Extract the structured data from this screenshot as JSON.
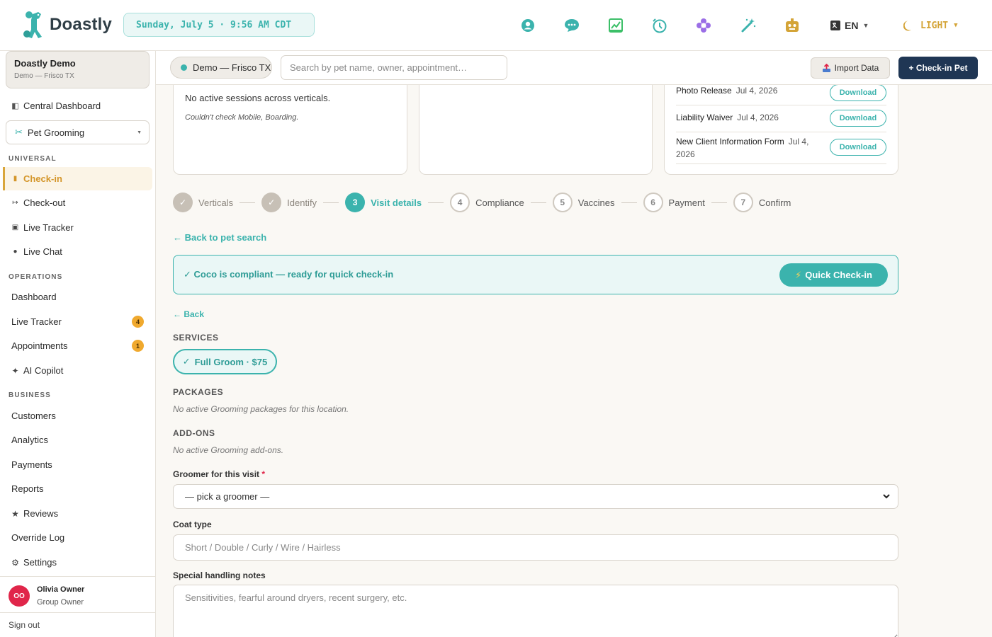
{
  "app": {
    "name": "Doastly"
  },
  "topbar": {
    "datetime": "Sunday, July 5 · 9:56 AM CDT",
    "icons": [
      "support-icon",
      "chat-icon",
      "analytics-icon",
      "timer-icon",
      "flower-icon",
      "magic-wand-icon",
      "robot-icon"
    ],
    "language": "EN",
    "theme": "LIGHT"
  },
  "sidebar": {
    "org": {
      "name": "Doastly Demo",
      "location": "Demo — Frisco TX"
    },
    "central_dashboard": "Central Dashboard",
    "vertical": "Pet Grooming",
    "sections": {
      "universal": "UNIVERSAL",
      "operations": "OPERATIONS",
      "business": "BUSINESS"
    },
    "universal_items": [
      {
        "label": "Check-in"
      },
      {
        "label": "Check-out"
      },
      {
        "label": "Live Tracker"
      },
      {
        "label": "Live Chat"
      }
    ],
    "operations_items": [
      {
        "label": "Dashboard"
      },
      {
        "label": "Live Tracker",
        "badge": "4"
      },
      {
        "label": "Appointments",
        "badge": "1"
      },
      {
        "label": "AI Copilot"
      }
    ],
    "business_items": [
      {
        "label": "Customers"
      },
      {
        "label": "Analytics"
      },
      {
        "label": "Payments"
      },
      {
        "label": "Reports"
      },
      {
        "label": "Reviews"
      },
      {
        "label": "Override Log"
      },
      {
        "label": "Settings"
      }
    ],
    "user": {
      "initials": "OO",
      "name": "Olivia Owner",
      "role": "Group Owner"
    },
    "signout": "Sign out"
  },
  "toolbar": {
    "location": "Demo — Frisco TX",
    "search_placeholder": "Search by pet name, owner, appointment…",
    "import_label": "Import Data",
    "checkin_label": "+ Check-in Pet"
  },
  "cards": {
    "sessions_text": "No active sessions across verticals.",
    "sessions_note": "Couldn't check Mobile, Boarding.",
    "documents": [
      {
        "name": "Photo Release",
        "date": "Jul 4, 2026",
        "action": "Download"
      },
      {
        "name": "Liability Waiver",
        "date": "Jul 4, 2026",
        "action": "Download"
      },
      {
        "name": "New Client Information Form",
        "date": "Jul 4, 2026",
        "action": "Download"
      }
    ]
  },
  "stepper": [
    {
      "num": "1",
      "label": "Verticals",
      "state": "done"
    },
    {
      "num": "2",
      "label": "Identify",
      "state": "done"
    },
    {
      "num": "3",
      "label": "Visit details",
      "state": "active"
    },
    {
      "num": "4",
      "label": "Compliance",
      "state": "todo"
    },
    {
      "num": "5",
      "label": "Vaccines",
      "state": "todo"
    },
    {
      "num": "6",
      "label": "Payment",
      "state": "todo"
    },
    {
      "num": "7",
      "label": "Confirm",
      "state": "todo"
    }
  ],
  "main": {
    "back_to_search": "← Back to pet search",
    "compliant_text": "✓ Coco is compliant — ready for quick check-in",
    "quick_checkin": "Quick Check-in",
    "back": "← Back",
    "services_heading": "SERVICES",
    "service_chip": "Full Groom · $75",
    "packages_heading": "PACKAGES",
    "packages_empty": "No active Grooming packages for this location.",
    "addons_heading": "ADD-ONS",
    "addons_empty": "No active Grooming add-ons.",
    "groomer_label": "Groomer for this visit",
    "groomer_required": "*",
    "groomer_value": "— pick a groomer —",
    "coat_label": "Coat type",
    "coat_placeholder": "Short / Double / Curly / Wire / Hairless",
    "notes_label": "Special handling notes",
    "notes_placeholder": "Sensitivities, fearful around dryers, recent surgery, etc."
  },
  "colors": {
    "accent": "#3bb3ad",
    "active_nav": "#d4962a",
    "primary_button": "#1f3654",
    "badge": "#f0a92e",
    "avatar": "#e0264a"
  }
}
